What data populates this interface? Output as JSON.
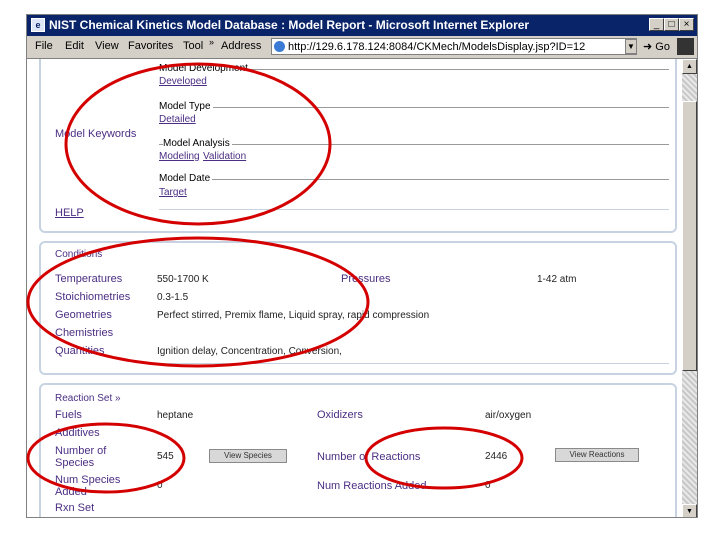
{
  "window": {
    "title": "NIST Chemical Kinetics Model Database : Model Report - Microsoft Internet Explorer",
    "app_icon": "e",
    "controls": [
      "_",
      "□",
      "×"
    ]
  },
  "menu": [
    "File",
    "Edit",
    "View",
    "Favorites",
    "Tool",
    "»"
  ],
  "address": {
    "label": "Address",
    "url": "http://129.6.178.124:8084/CKMech/ModelsDisplay.jsp?ID=12",
    "go_label": "Go"
  },
  "keywords_panel": {
    "label": "Model Keywords",
    "groups": [
      {
        "legend": "Model Development",
        "links": [
          "Developed"
        ]
      },
      {
        "legend": "Model Type",
        "links": [
          "Detailed"
        ]
      },
      {
        "legend": "Model Analysis",
        "links": [
          "Modeling",
          "Validation"
        ]
      },
      {
        "legend": "Model Date",
        "links": [
          "Target"
        ]
      }
    ],
    "help_label": "HELP"
  },
  "conditions_panel": {
    "title": "Conditions",
    "temperatures": {
      "label": "Temperatures",
      "value": "550-1700 K"
    },
    "pressures": {
      "label": "Pressures",
      "value": "1-42 atm"
    },
    "stoichiometries": {
      "label": "Stoichiometries",
      "value": "0.3-1.5"
    },
    "geometries": {
      "label": "Geometries",
      "value": "Perfect stirred, Premix flame, Liquid spray, rapid compression"
    },
    "chemistries": {
      "label": "Chemistries",
      "value": ""
    },
    "quantities": {
      "label": "Quantities",
      "value": "Ignition delay, Concentration, Conversion,"
    }
  },
  "reaction_panel": {
    "title": "Reaction Set »",
    "fuels": {
      "label": "Fuels",
      "value": "heptane"
    },
    "oxidizers": {
      "label": "Oxidizers",
      "value": "air/oxygen"
    },
    "additives": {
      "label": "Additives",
      "value": ""
    },
    "num_species": {
      "label": "Number of Species",
      "value": "545",
      "button": "View Species"
    },
    "num_reactions": {
      "label": "Number of Reactions",
      "value": "2446",
      "button": "View Reactions"
    },
    "num_species_added": {
      "label": "Num Species Added",
      "value": "0"
    },
    "num_reactions_added": {
      "label": "Num Reactions Added",
      "value": "0"
    },
    "rxn_set": {
      "label": "Rxn Set"
    }
  },
  "colors": {
    "annotation": "#d40000",
    "label": "#4b2e83",
    "titlebar": "#0a246a"
  }
}
